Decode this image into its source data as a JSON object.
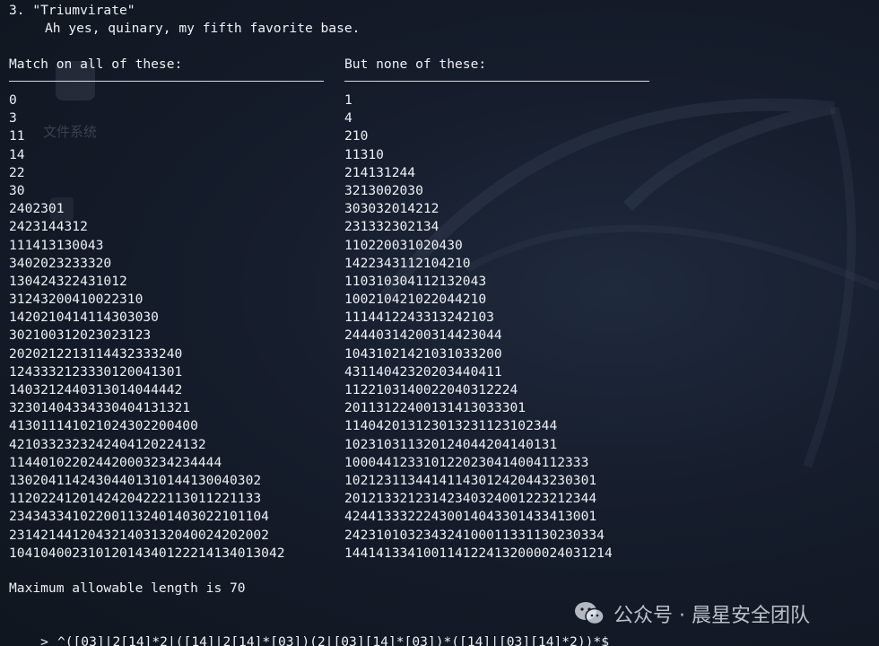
{
  "watermark": {
    "text": "公众号 · 晨星安全团队",
    "icon": "wechat-icon"
  },
  "desktop": {
    "icon_label": "文件系统"
  },
  "challenge": {
    "title": "3. \"Triumvirate\"",
    "description": "Ah yes, quinary, my fifth favorite base.",
    "match_header": "Match on all of these:",
    "nomatch_header": "But none of these:",
    "match_items": [
      "0",
      "3",
      "11",
      "14",
      "22",
      "30",
      "2402301",
      "2423144312",
      "111413130043",
      "3402023233320",
      "130424322431012",
      "31243200410022310",
      "1420210414114303030",
      "302100312023023123",
      "2020212213114432333240",
      "124333212333012004130​1",
      "1403212440313014044442",
      "3230140433433040413132​1",
      "41301114102102430220040​0",
      "42103323232424041202241​32",
      "1144010220244200032342344​44",
      "1302041142430440131014413004030​2",
      "1120224120142420422211301122113​3",
      "2343433410220011324014030221011​04",
      "2314214412043214031320400242020​02",
      "10410400231012014340122214134013042"
    ],
    "nomatch_items": [
      "1",
      "4",
      "210",
      "11310",
      "214131244",
      "3213002030",
      "303032014212",
      "231332302134",
      "110220031020430",
      "1422343112104210",
      "110310304112132043",
      "100210421022044210",
      "1114412243313242103",
      "24440314200314423044",
      "10431021421031033200",
      "43114042320203440411",
      "1122103140022040312224",
      "20113122400131413033301",
      "11404201312301323112310234​4",
      "10231031132012404420414013​1",
      "1000441233101220230414004112333",
      "1021231134414114301242044323030​1",
      "2012133212314234032400122321234​4",
      "4244133322243001404330143341300​1",
      "2423101032343241000113311302303​34",
      "1441413341001141224132000024031214"
    ],
    "max_length_text": "Maximum allowable length is 70",
    "prompt_symbol": ">",
    "prompt_input": "^([03]|2[14]*2|([14]|2[14]*[03])(2|[03][14]*[03])*([14]|[03][14]*2))*$"
  }
}
